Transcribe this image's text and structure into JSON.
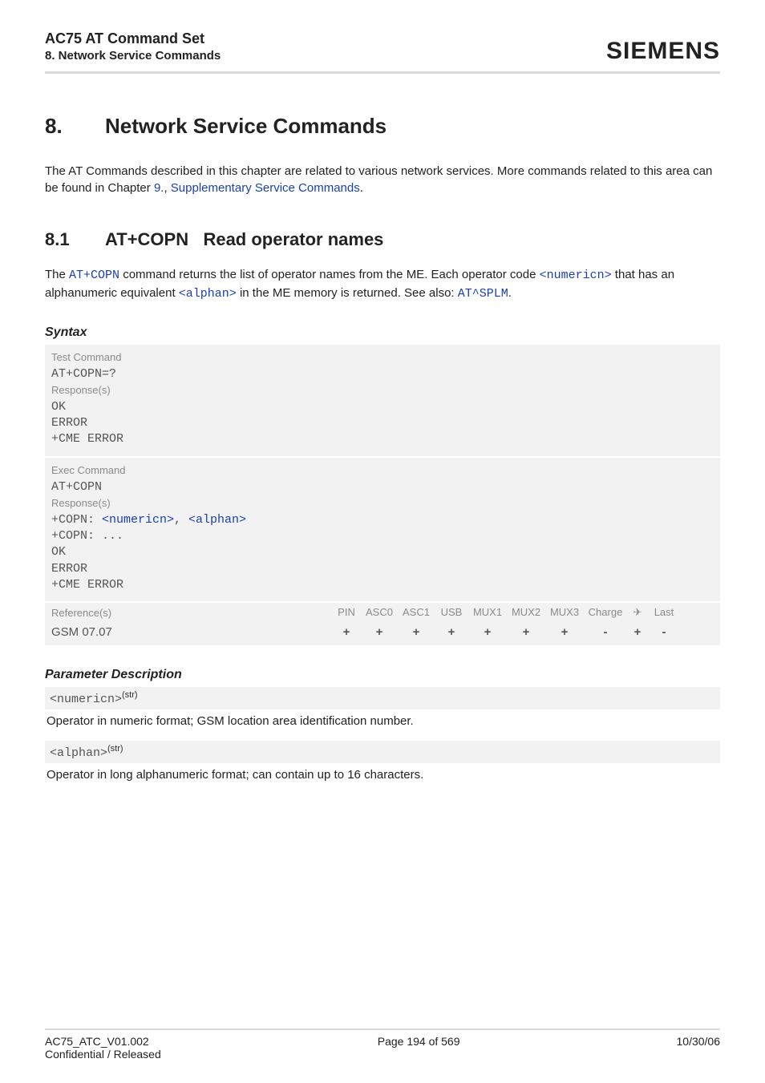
{
  "header": {
    "title": "AC75 AT Command Set",
    "subtitle": "8. Network Service Commands",
    "brand": "SIEMENS"
  },
  "chapter": {
    "num": "8.",
    "title": "Network Service Commands"
  },
  "intro": {
    "pre": "The AT Commands described in this chapter are related to various network services. More commands related to this area can be found in Chapter ",
    "link1": "9.",
    "mid": ", ",
    "link2": "Supplementary Service Commands",
    "post": "."
  },
  "section": {
    "num": "8.1",
    "cmd": "AT+COPN",
    "title": "Read operator names"
  },
  "sec_para": {
    "t1": "The ",
    "l1": "AT+COPN",
    "t2": " command returns the list of operator names from the ME. Each operator code ",
    "l2": "<numericn>",
    "t3": " that has an alphanumeric equivalent ",
    "l3": "<alphan>",
    "t4": " in the ME memory is returned. See also: ",
    "l4": "AT^SPLM",
    "t5": "."
  },
  "syntax_label": "Syntax",
  "test_cmd": {
    "label": "Test Command",
    "cmd": "AT+COPN=?",
    "resp_label": "Response(s)",
    "r1": "OK",
    "r2": "ERROR",
    "r3": "+CME ERROR"
  },
  "exec_cmd": {
    "label": "Exec Command",
    "cmd": "AT+COPN",
    "resp_label": "Response(s)",
    "r1a": "+COPN: ",
    "r1b": "<numericn>",
    "r1c": ", ",
    "r1d": "<alphan>",
    "r2": "+COPN: ...",
    "r3": "OK",
    "r4": "ERROR",
    "r5": "+CME ERROR"
  },
  "ref": {
    "label": "Reference(s)",
    "cols": {
      "pin": "PIN",
      "asc0": "ASC0",
      "asc1": "ASC1",
      "usb": "USB",
      "mux1": "MUX1",
      "mux2": "MUX2",
      "mux3": "MUX3",
      "charge": "Charge",
      "air": "✈",
      "last": "Last"
    },
    "value": "GSM 07.07",
    "vals": {
      "pin": "+",
      "asc0": "+",
      "asc1": "+",
      "usb": "+",
      "mux1": "+",
      "mux2": "+",
      "mux3": "+",
      "charge": "-",
      "air": "+",
      "last": "-"
    }
  },
  "pdesc_label": "Parameter Description",
  "p1": {
    "name": "<numericn>",
    "sup": "(str)",
    "desc": "Operator in numeric format; GSM location area identification number."
  },
  "p2": {
    "name": "<alphan>",
    "sup": "(str)",
    "desc": "Operator in long alphanumeric format; can contain up to 16 characters."
  },
  "footer": {
    "left1": "AC75_ATC_V01.002",
    "left2": "Confidential / Released",
    "center": "Page 194 of 569",
    "right": "10/30/06"
  }
}
